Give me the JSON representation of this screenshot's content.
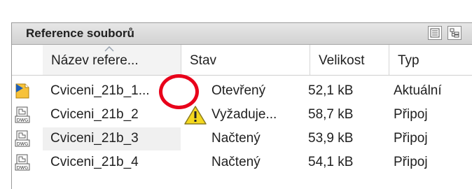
{
  "panel": {
    "title": "Reference souborů",
    "view_buttons": [
      {
        "icon": "list-view-icon"
      },
      {
        "icon": "tree-view-icon"
      }
    ]
  },
  "columns": {
    "name": "Název refere...",
    "status": "Stav",
    "size": "Velikost",
    "type": "Typ",
    "sorted_by": "name",
    "sort_direction": "ascending"
  },
  "rows": [
    {
      "icon": "dwg-current-drawing-icon",
      "name": "Cviceni_21b_1...",
      "status": "Otevřený",
      "size": "52,1 kB",
      "type": "Aktuální"
    },
    {
      "icon": "dwg-file-icon",
      "name": "Cviceni_21b_2",
      "status": "Vyžaduje...",
      "size": "58,7 kB",
      "type": "Připoj",
      "warning_icon": "warning-icon"
    },
    {
      "icon": "dwg-file-icon",
      "name": "Cviceni_21b_3",
      "status": "Načtený",
      "size": "53,9 kB",
      "type": "Připoj",
      "selected": true
    },
    {
      "icon": "dwg-file-icon",
      "name": "Cviceni_21b_4",
      "status": "Načtený",
      "size": "54,1 kB",
      "type": "Připoj"
    }
  ],
  "annotation": {
    "shape": "red-circle",
    "target": "warning-icon",
    "color": "#e8001a"
  },
  "colors": {
    "header_bg": "#dcdcdc",
    "warning_yellow": "#f4d81e",
    "annotation_red": "#e8001a"
  }
}
